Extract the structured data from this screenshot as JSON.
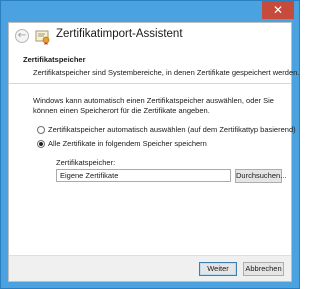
{
  "window": {
    "close_glyph": "✕"
  },
  "header": {
    "back_glyph": "←",
    "app_icon": "certificate-import-icon",
    "title": "Zertifikatimport-Assistent"
  },
  "section": {
    "title": "Zertifikatspeicher",
    "description": "Zertifikatspeicher sind Systembereiche, in denen Zertifikate gespeichert werden."
  },
  "info": {
    "text": "Windows kann automatisch einen Zertifikatspeicher auswählen, oder Sie können einen Speicherort für die Zertifikate angeben."
  },
  "options": {
    "auto_label": "Zertifikatspeicher automatisch auswählen (auf dem Zertifikattyp basierend)",
    "manual_label": "Alle Zertifikate in folgendem Speicher speichern",
    "selected": "manual"
  },
  "store": {
    "label": "Zertifikatspeicher:",
    "value": "Eigene Zertifikate",
    "browse_label": "Durchsuchen..."
  },
  "footer": {
    "next_label": "Weiter",
    "cancel_label": "Abbrechen"
  },
  "colors": {
    "titlebar": "#4aa3df",
    "close": "#c74b3c",
    "default_button_border": "#3c7fb1"
  }
}
